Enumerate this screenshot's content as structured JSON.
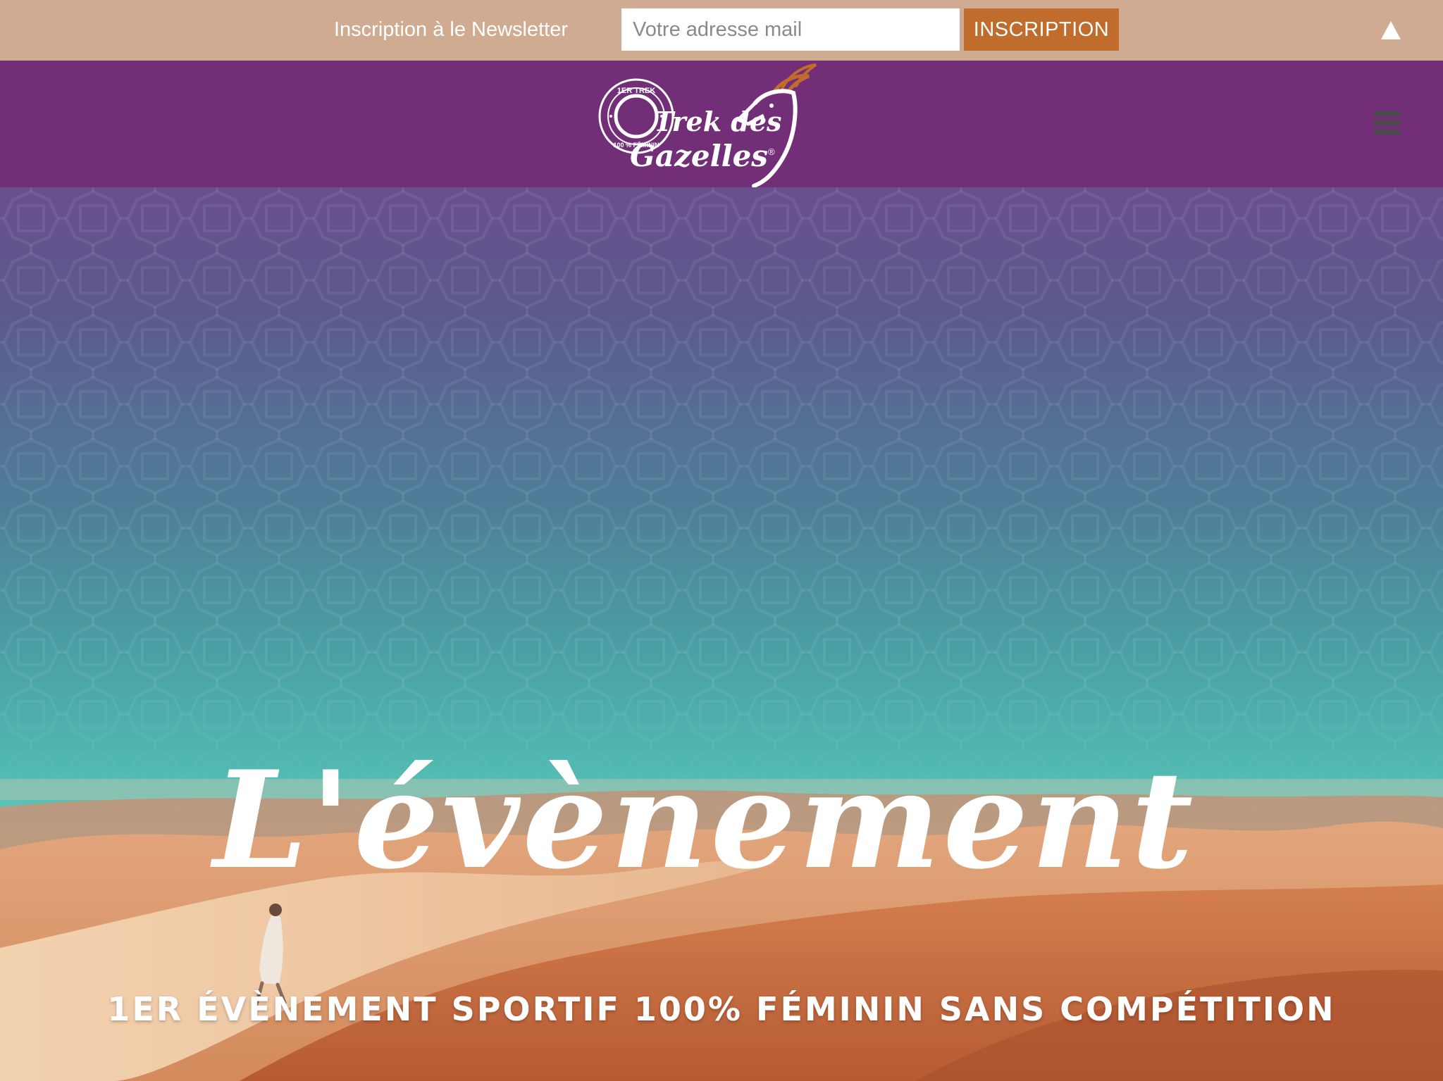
{
  "newsletter": {
    "label": "Inscription à le Newsletter",
    "email_placeholder": "Votre adresse mail",
    "email_value": "",
    "submit_label": "INSCRIPTION",
    "scroll_top_icon": "up-arrow-icon"
  },
  "header": {
    "logo": {
      "badge_top": "1ER TREK",
      "badge_bottom": "100 % FÉMININ",
      "brand_line1": "Trek des",
      "brand_line2": "Gazelles",
      "registered_mark": "®"
    },
    "menu_icon": "hamburger-menu-icon"
  },
  "hero": {
    "title": "L'évènement",
    "subtitle": "1ER ÉVÈNEMENT SPORTIF 100% FÉMININ SANS COMPÉTITION"
  },
  "colors": {
    "newsletter_bg": "#cfab92",
    "newsletter_button": "#c06c2c",
    "header_bg": "#722f78",
    "sky_top": "#694f8e",
    "sky_bottom": "#64c7bb",
    "sand": "#c86f42"
  }
}
